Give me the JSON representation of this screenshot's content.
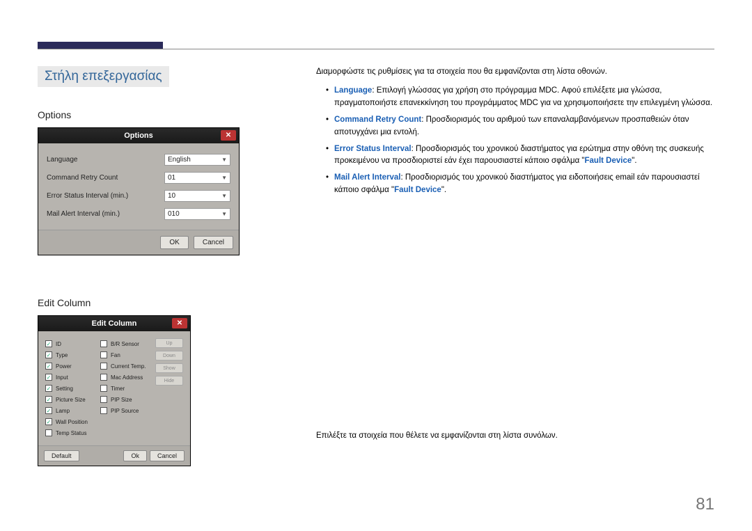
{
  "page_number": "81",
  "section_title": "Στήλη επεξεργασίας",
  "options": {
    "heading": "Options",
    "dialog_title": "Options",
    "rows": {
      "language_label": "Language",
      "language_value": "English",
      "retry_label": "Command Retry Count",
      "retry_value": "01",
      "error_label": "Error Status Interval (min.)",
      "error_value": "10",
      "mail_label": "Mail Alert Interval (min.)",
      "mail_value": "010"
    },
    "ok": "OK",
    "cancel": "Cancel"
  },
  "options_desc": {
    "intro": "Διαμορφώστε τις ρυθμίσεις για τα στοιχεία που θα εμφανίζονται στη λίστα οθονών.",
    "b1_kw": "Language",
    "b1_txt": ": Επιλογή γλώσσας για χρήση στο πρόγραμμα MDC. Αφού επιλέξετε μια γλώσσα, πραγματοποιήστε επανεκκίνηση του προγράμματος MDC για να χρησιμοποιήσετε την επιλεγμένη γλώσσα.",
    "b2_kw": "Command Retry Count",
    "b2_txt": ": Προσδιορισμός του αριθμού των επαναλαμβανόμενων προσπαθειών όταν αποτυγχάνει μια εντολή.",
    "b3_kw": "Error Status Interval",
    "b3_txt_a": ": Προσδιορισμός του χρονικού διαστήματος για ερώτημα στην οθόνη της συσκευής προκειμένου να προσδιοριστεί εάν έχει παρουσιαστεί κάποιο σφάλμα \"",
    "b3_fd": "Fault Device",
    "b3_txt_b": "\".",
    "b4_kw": "Mail Alert Interval",
    "b4_txt_a": ": Προσδιορισμός του χρονικού διαστήματος για ειδοποιήσεις email εάν παρουσιαστεί κάποιο σφάλμα \"",
    "b4_fd": "Fault Device",
    "b4_txt_b": "\"."
  },
  "editcol": {
    "heading": "Edit Column",
    "dialog_title": "Edit Column",
    "col1": [
      "ID",
      "Type",
      "Power",
      "Input",
      "Setting",
      "Picture Size",
      "Lamp",
      "Wall Position",
      "Temp Status"
    ],
    "col1_checked": [
      true,
      true,
      true,
      true,
      true,
      true,
      true,
      true,
      false
    ],
    "col2": [
      "B/R Sensor",
      "Fan",
      "Current Temp.",
      "Mac Address",
      "Timer",
      "PIP Size",
      "PIP Source"
    ],
    "col2_checked": [
      false,
      false,
      false,
      false,
      false,
      false,
      false
    ],
    "side": [
      "Up",
      "Down",
      "Show",
      "Hide"
    ],
    "default": "Default",
    "ok": "Ok",
    "cancel": "Cancel",
    "desc": "Επιλέξτε τα στοιχεία που θέλετε να εμφανίζονται στη λίστα συνόλων."
  }
}
